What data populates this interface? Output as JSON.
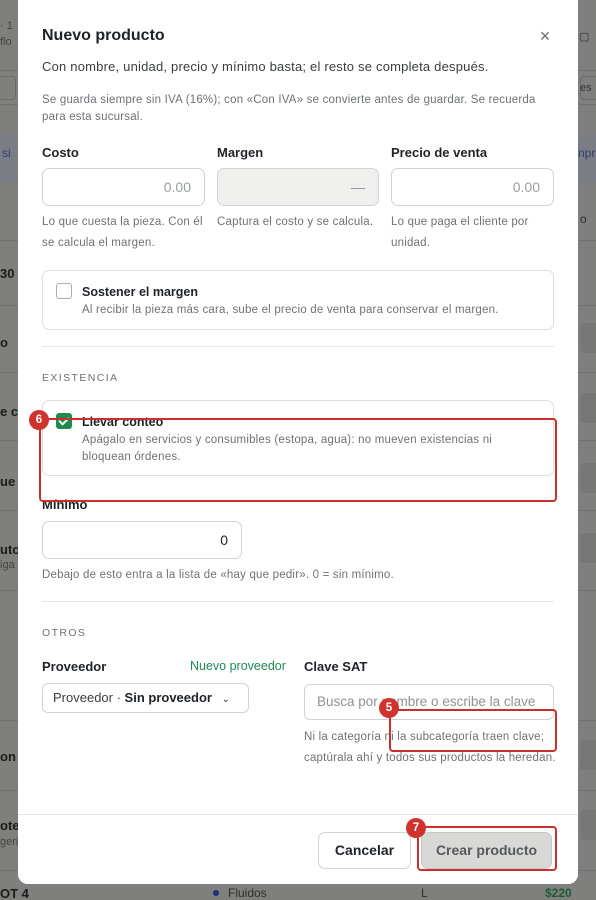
{
  "background": {
    "fragments": {
      "top_a": "· 1",
      "top_b": "flo",
      "chip_right": "es",
      "left_link": "si",
      "right_link": "npre",
      "right_o": "o",
      "row_30": "30",
      "row_o": "o",
      "row_c": "e c",
      "row_ue": "ue",
      "row_ut": "uto",
      "row_ig": "iga",
      "row_on": "on",
      "row_ot": "ote",
      "row_ri": "geri",
      "row_ot4": "OT 4",
      "row_fluidos": "Fluidos",
      "row_l": "L",
      "row_price": "$220"
    }
  },
  "modal": {
    "title": "Nuevo producto",
    "subtitle": "Con nombre, unidad, precio y mínimo basta; el resto se completa después.",
    "note": "Se guarda siempre sin IVA (16%); con «Con IVA» se convierte antes de guardar. Se recuerda para esta sucursal.",
    "cost": {
      "label": "Costo",
      "value": "0.00",
      "help": "Lo que cuesta la pieza. Con él se calcula el margen."
    },
    "margin": {
      "label": "Margen",
      "value": "—",
      "help": "Captura el costo y se calcula."
    },
    "price": {
      "label": "Precio de venta",
      "value": "0.00",
      "help": "Lo que paga el cliente por unidad."
    },
    "keep_margin": {
      "title": "Sostener el margen",
      "desc": "Al recibir la pieza más cara, sube el precio de venta para conservar el margen.",
      "checked": false
    },
    "stock_section": "EXISTENCIA",
    "track_stock": {
      "title": "Llevar conteo",
      "desc": "Apágalo en servicios y consumibles (estopa, agua): no mueven existencias ni bloquean órdenes.",
      "checked": true
    },
    "minimum": {
      "label": "Mínimo",
      "value": "0",
      "help": "Debajo de esto entra a la lista de «hay que pedir». 0 = sin mínimo."
    },
    "others_section": "OTROS",
    "supplier": {
      "label": "Proveedor",
      "new_link": "Nuevo proveedor",
      "prefix": "Proveedor ·",
      "value": "Sin proveedor"
    },
    "sat": {
      "label": "Clave SAT",
      "placeholder": "Busca por nombre o escribe la clave",
      "help": "Ni la categoría ni la subcategoría traen clave; captúrala ahí y todos sus productos la heredan."
    },
    "close_symbol": "×",
    "cancel_label": "Cancelar",
    "create_label": "Crear producto"
  },
  "annotations": {
    "badge_5": "5",
    "badge_6": "6",
    "badge_7": "7",
    "color": "#c9302c"
  }
}
